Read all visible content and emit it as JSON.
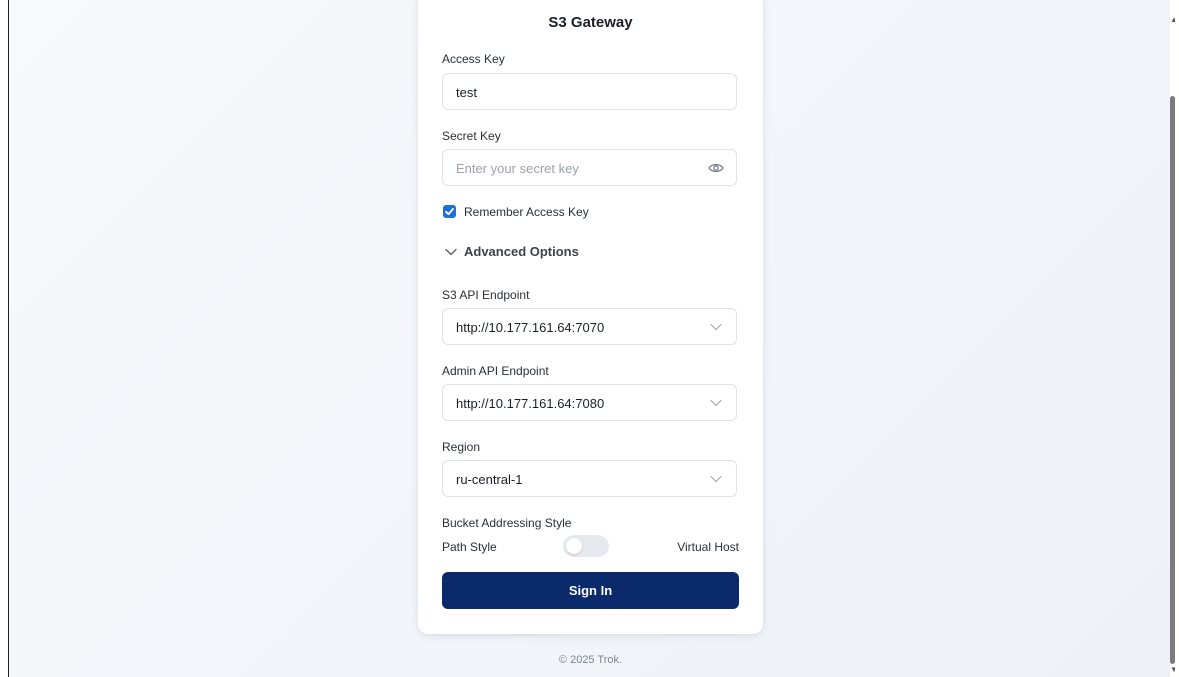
{
  "login": {
    "title": "S3 Gateway",
    "access_key": {
      "label": "Access Key",
      "value": "test"
    },
    "secret_key": {
      "label": "Secret Key",
      "placeholder": "Enter your secret key",
      "icon": "eye-icon"
    },
    "remember": {
      "label": "Remember Access Key",
      "checked": true
    },
    "advanced": {
      "label": "Advanced Options",
      "expanded": true,
      "s3_endpoint": {
        "label": "S3 API Endpoint",
        "value": "http://10.177.161.64:7070"
      },
      "admin_endpoint": {
        "label": "Admin API Endpoint",
        "value": "http://10.177.161.64:7080"
      },
      "region": {
        "label": "Region",
        "value": "ru-central-1"
      },
      "addressing": {
        "label": "Bucket Addressing Style",
        "left": "Path Style",
        "right": "Virtual Host",
        "virtual_host_enabled": false
      }
    },
    "signin_label": "Sign In"
  },
  "footer": {
    "text": "© 2025 Trok."
  },
  "colors": {
    "primary": "#0a2a6c",
    "checkbox": "#1f6fd6",
    "toggle_off": "#e6e9ee"
  }
}
